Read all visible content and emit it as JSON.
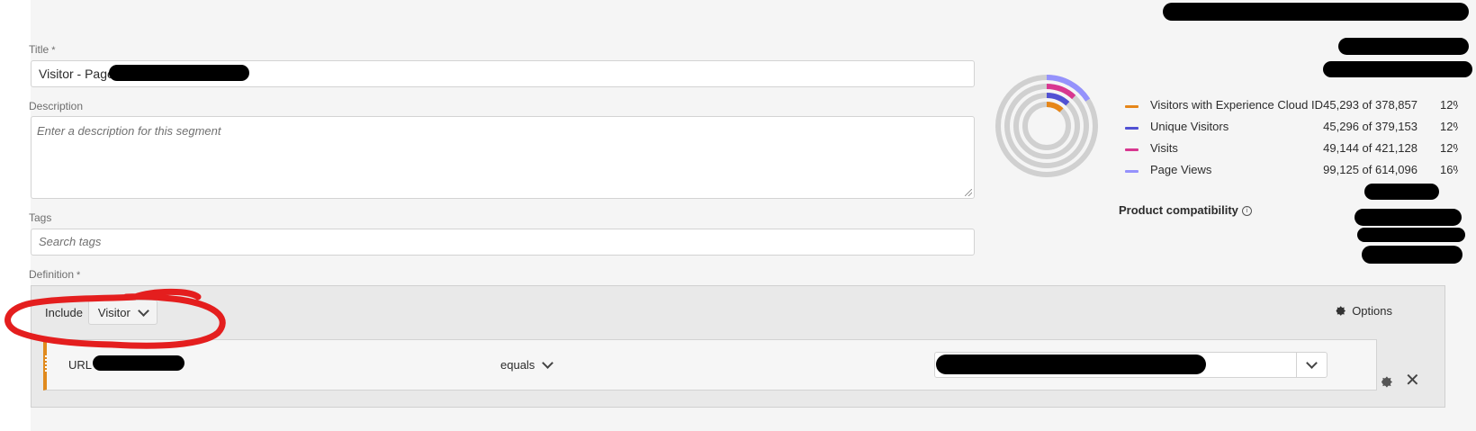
{
  "form": {
    "title_label": "Title",
    "title_value": "Visitor - Page",
    "description_label": "Description",
    "description_placeholder": "Enter a description for this segment",
    "tags_label": "Tags",
    "tags_placeholder": "Search tags",
    "definition_label": "Definition",
    "required_mark": "*"
  },
  "summary": {
    "legend": [
      {
        "label": "Visitors with Experience Cloud ID",
        "count": "45,293 of 378,857",
        "pct": "12%",
        "color": "#e68619",
        "fraction": 0.12
      },
      {
        "label": "Unique Visitors",
        "count": "45,296 of 379,153",
        "pct": "12%",
        "color": "#5151d3",
        "fraction": 0.12
      },
      {
        "label": "Visits",
        "count": "49,144 of 421,128",
        "pct": "12%",
        "color": "#d83790",
        "fraction": 0.12
      },
      {
        "label": "Page Views",
        "count": "99,125 of 614,096",
        "pct": "16%",
        "color": "#9592fc",
        "fraction": 0.16
      }
    ],
    "compatibility_label": "Product compatibility"
  },
  "definition": {
    "include_label": "Include",
    "scope_value": "Visitor",
    "options_label": "Options",
    "rule": {
      "dimension": "URL",
      "operator": "equals"
    }
  },
  "colors": {
    "accent_orange": "#e08a1e",
    "annotation_red": "#e41e1e"
  },
  "icons": {
    "options": "gear-icon",
    "rule_settings": "gear-icon",
    "rule_remove": "close-icon",
    "info": "info-icon",
    "dropdown": "chevron-down-icon"
  }
}
